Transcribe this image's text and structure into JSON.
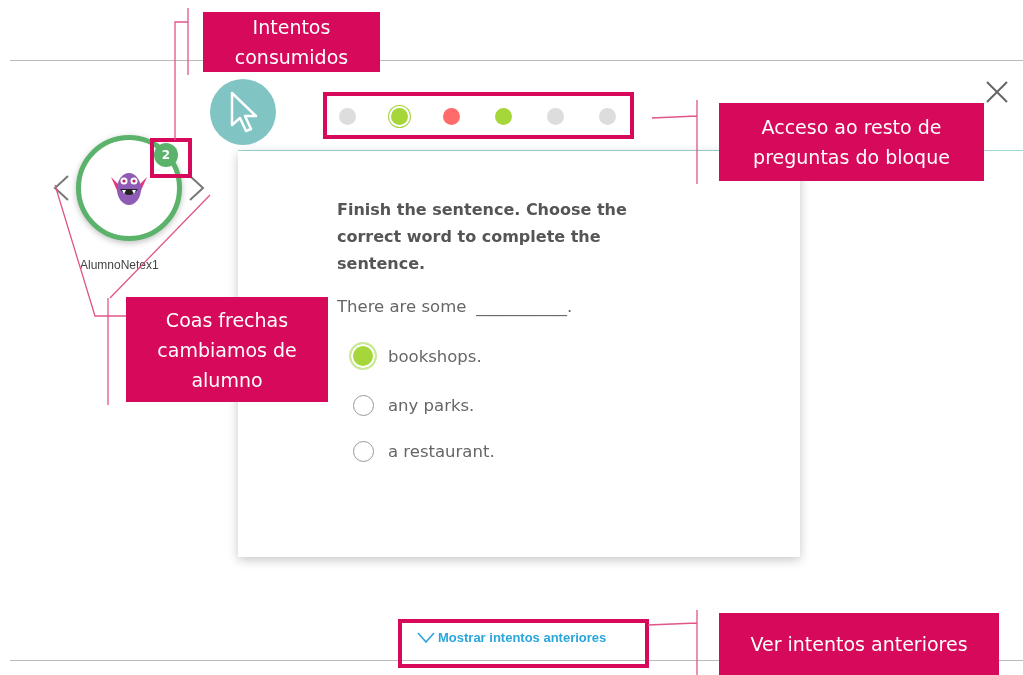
{
  "student": {
    "name": "AlumnoNetex1",
    "attempts": "2"
  },
  "question_nav": [
    {
      "color": "#dddddd",
      "selected": false
    },
    {
      "color": "#a5d63a",
      "selected": true
    },
    {
      "color": "#ff6b6b",
      "selected": false
    },
    {
      "color": "#a5d63a",
      "selected": false
    },
    {
      "color": "#dddddd",
      "selected": false
    },
    {
      "color": "#dddddd",
      "selected": false
    }
  ],
  "question": {
    "instruction": "Finish the sentence. Choose the correct word to complete the sentence.",
    "prompt": "There are some",
    "blank": "___________.",
    "options": [
      {
        "label": "bookshops.",
        "selected": true
      },
      {
        "label": "any parks.",
        "selected": false
      },
      {
        "label": "a restaurant.",
        "selected": false
      }
    ]
  },
  "show_previous": {
    "label": "Mostrar intentos anteriores"
  },
  "callouts": [
    {
      "text": "Intentos consumidos"
    },
    {
      "text": "Acceso ao resto de preguntas do bloque"
    },
    {
      "text": "Coas frechas cambiamos de alumno"
    },
    {
      "text": "Ver intentos anteriores"
    }
  ]
}
